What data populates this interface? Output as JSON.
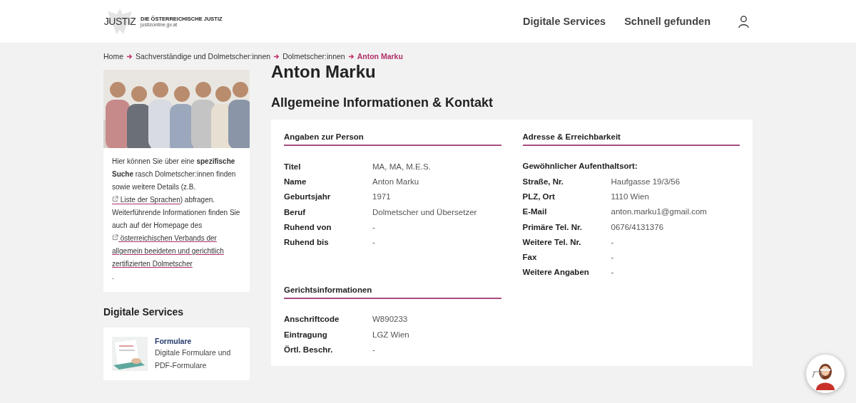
{
  "header": {
    "logo": "JUSTIZ",
    "org_name": "DIE ÖSTERREICHISCHE JUSTIZ",
    "org_url": "justizonline.gv.at",
    "nav": [
      "Digitale Services",
      "Schnell gefunden"
    ]
  },
  "breadcrumb": [
    {
      "label": "Home",
      "current": false
    },
    {
      "label": "Sachverständige und Dolmetscher:innen",
      "current": false
    },
    {
      "label": "Dolmetscher:innen",
      "current": false
    },
    {
      "label": "Anton Marku",
      "current": true
    }
  ],
  "page_title": "Anton Marku",
  "sidebar": {
    "intro": [
      {
        "kind": "text",
        "text": "Hier können Sie über eine **spezifische Suche** rasch Dolmetscher:innen finden sowie weitere Details (z.B. "
      },
      {
        "kind": "link",
        "text": "Liste der Sprachen"
      },
      {
        "kind": "text",
        "text": ") abfragen. Weiterführende Informationen finden Sie auch auf der Homepage des "
      },
      {
        "kind": "block_link",
        "text": "österreichischen Verbands der allgemein beeideten und gerichtlich zertifizierten Dolmetscher"
      },
      {
        "kind": "text",
        "text": "."
      }
    ],
    "services_title": "Digitale Services",
    "services": [
      {
        "title": "Formulare",
        "description": "Digitale Formulare und PDF-Formulare"
      }
    ]
  },
  "section_title": "Allgemeine Informationen & Kontakt",
  "columns": [
    [
      {
        "title": "Angaben zur Person",
        "rows": [
          {
            "label": "Titel",
            "value": "MA, MA, M.E.S."
          },
          {
            "label": "Name",
            "value": "Anton Marku"
          },
          {
            "label": "Geburtsjahr",
            "value": "1971"
          },
          {
            "label": "Beruf",
            "value": "Dolmetscher und Übersetzer"
          },
          {
            "label": "Ruhend von",
            "value": "-"
          },
          {
            "label": "Ruhend bis",
            "value": "-"
          }
        ]
      },
      {
        "title": "Gerichtsinformationen",
        "rows": [
          {
            "label": "Anschriftcode",
            "value": "W890233"
          },
          {
            "label": "Eintragung",
            "value": "LGZ Wien"
          },
          {
            "label": "Örtl. Beschr.",
            "value": "-"
          }
        ]
      }
    ],
    [
      {
        "title": "Adresse & Erreichbarkeit",
        "subtitle": "Gewöhnlicher Aufenthaltsort:",
        "rows": [
          {
            "label": "Straße, Nr.",
            "value": "Haufgasse 19/3/56"
          },
          {
            "label": "PLZ, Ort",
            "value": "1110 Wien"
          },
          {
            "label": "E-Mail",
            "value": "anton.marku1@gmail.com"
          },
          {
            "label": "Primäre Tel. Nr.",
            "value": "0676/4131376"
          },
          {
            "label": "Weitere Tel. Nr.",
            "value": "-"
          },
          {
            "label": "Fax",
            "value": "-"
          },
          {
            "label": "Weitere Angaben",
            "value": "-"
          }
        ]
      }
    ]
  ]
}
